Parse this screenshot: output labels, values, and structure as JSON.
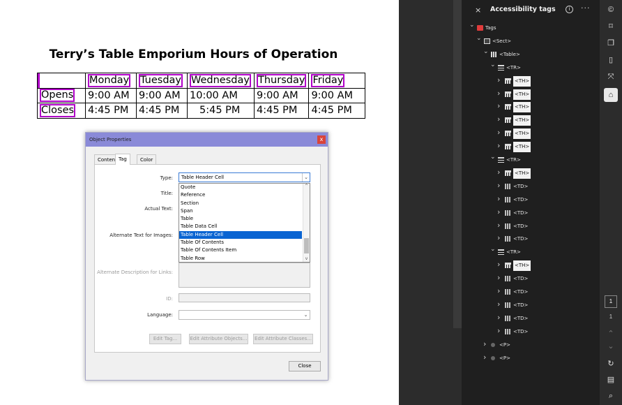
{
  "document": {
    "title": "Terry’s Table Emporium Hours of Operation",
    "table": {
      "rows": [
        [
          "",
          "Monday",
          "Tuesday",
          "Wednesday",
          "Thursday",
          "Friday"
        ],
        [
          "Opens",
          "9:00 AM",
          "9:00 AM",
          "10:00 AM",
          "9:00 AM",
          "9:00 AM"
        ],
        [
          "Closes",
          "4:45 PM",
          "4:45 PM",
          "5:45 PM",
          "4:45 PM",
          "4:45 PM"
        ]
      ]
    },
    "highlight_color": "#b000c8"
  },
  "dialog": {
    "title": "Object Properties",
    "close_label": "x",
    "tabs": [
      "Content",
      "Tag",
      "Color"
    ],
    "active_tab": "Tag",
    "labels": {
      "type": "Type:",
      "title": "Title:",
      "actual_text": "Actual Text:",
      "alt_text": "Alternate Text for Images:",
      "alt_desc": "Alternate Description for Links:",
      "id": "ID:",
      "language": "Language:"
    },
    "type_value": "Table Header Cell",
    "type_options": [
      "Quote",
      "Reference",
      "Section",
      "Span",
      "Table",
      "Table Data Cell",
      "Table Header Cell",
      "Table Of Contents",
      "Table Of Contents Item",
      "Table Row"
    ],
    "buttons": {
      "edit_tag": "Edit Tag...",
      "edit_attr_objects": "Edit Attribute Objects...",
      "edit_attr_classes": "Edit Attribute Classes...",
      "close": "Close"
    }
  },
  "panel": {
    "title": "Accessibility tags",
    "close_icon": "×",
    "info_icon": "i",
    "more_icon": "···",
    "tree": [
      {
        "label": "Tags",
        "icon": "tags-icon",
        "twisty": "v"
      },
      {
        "label": "<Sect>",
        "icon": "sect-icon",
        "twisty": "v"
      },
      {
        "label": "<Table>",
        "icon": "table-icon",
        "twisty": "v"
      },
      {
        "label": "<TR>",
        "icon": "tr-icon",
        "twisty": "v"
      },
      {
        "label": "<TH>",
        "icon": "th-icon",
        "twisty": ">"
      },
      {
        "label": "<TH>",
        "icon": "th-icon",
        "twisty": ">"
      },
      {
        "label": "<TH>",
        "icon": "th-icon",
        "twisty": ">"
      },
      {
        "label": "<TH>",
        "icon": "th-icon",
        "twisty": ">"
      },
      {
        "label": "<TH>",
        "icon": "th-icon",
        "twisty": ">"
      },
      {
        "label": "<TH>",
        "icon": "th-icon",
        "twisty": ">"
      },
      {
        "label": "<TR>",
        "icon": "tr-icon",
        "twisty": "v"
      },
      {
        "label": "<TH>",
        "icon": "th-icon",
        "twisty": ">"
      },
      {
        "label": "<TD>",
        "icon": "td-icon",
        "twisty": ">"
      },
      {
        "label": "<TD>",
        "icon": "td-icon",
        "twisty": ">"
      },
      {
        "label": "<TD>",
        "icon": "td-icon",
        "twisty": ">"
      },
      {
        "label": "<TD>",
        "icon": "td-icon",
        "twisty": ">"
      },
      {
        "label": "<TD>",
        "icon": "td-icon",
        "twisty": ">"
      },
      {
        "label": "<TR>",
        "icon": "tr-icon",
        "twisty": "v"
      },
      {
        "label": "<TH>",
        "icon": "th-icon",
        "twisty": ">"
      },
      {
        "label": "<TD>",
        "icon": "td-icon",
        "twisty": ">"
      },
      {
        "label": "<TD>",
        "icon": "td-icon",
        "twisty": ">"
      },
      {
        "label": "<TD>",
        "icon": "td-icon",
        "twisty": ">"
      },
      {
        "label": "<TD>",
        "icon": "td-icon",
        "twisty": ">"
      },
      {
        "label": "<TD>",
        "icon": "td-icon",
        "twisty": ">"
      },
      {
        "label": "<P>",
        "icon": "p-icon",
        "twisty": ">"
      },
      {
        "label": "<P>",
        "icon": "p-icon",
        "twisty": ">"
      }
    ]
  },
  "toolbar": {
    "page_current": "1",
    "page_total": "1"
  }
}
